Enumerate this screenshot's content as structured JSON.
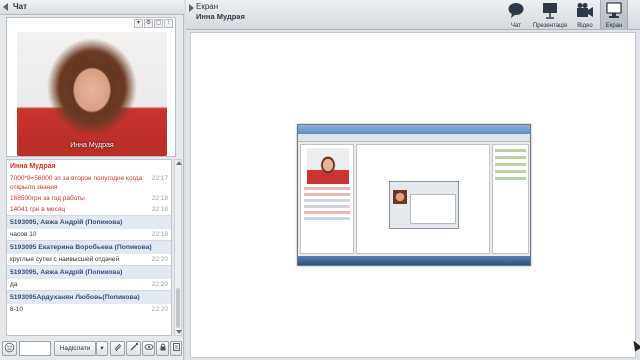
{
  "chat_panel": {
    "title": "Чат",
    "video": {
      "caption": "Инна Мудрая"
    },
    "messages": [
      {
        "type": "sender",
        "name": "Инна Мудрая"
      },
      {
        "type": "msg",
        "text": "7000*8=56000 зп за второе полугодие когда открыли звания",
        "time": "22:17",
        "style": "red"
      },
      {
        "type": "msg",
        "text": "168500грн за год работы",
        "time": "22:18",
        "style": "red"
      },
      {
        "type": "msg",
        "text": "14041 грн в месяц",
        "time": "22:18",
        "style": "red"
      },
      {
        "type": "sender",
        "name": "5193095, Авжа Андрій (Попикова)"
      },
      {
        "type": "msg",
        "text": "часов 10",
        "time": "22:19",
        "style": "plain"
      },
      {
        "type": "sender",
        "name": "5193095 Екатерина Воробьева (Попикова)"
      },
      {
        "type": "msg",
        "text": "круглые сутки с наивысшей отдачей",
        "time": "22:20",
        "style": "plain"
      },
      {
        "type": "sender",
        "name": "5193095, Авжа Андрій (Попикова)"
      },
      {
        "type": "msg",
        "text": "да",
        "time": "22:20",
        "style": "plain"
      },
      {
        "type": "sender",
        "name": "5193095Ардуханян Любовь(Попикова)"
      },
      {
        "type": "msg",
        "text": "8-10",
        "time": "22:20",
        "style": "plain"
      }
    ],
    "send_label": "Надіслати",
    "input_value": ""
  },
  "screen_panel": {
    "title": "Екран",
    "subtitle": "Инна Мудрая",
    "tools": [
      {
        "label": "Чат",
        "icon": "chat-bubble-icon",
        "active": false
      },
      {
        "label": "Презентація",
        "icon": "presentation-icon",
        "active": false
      },
      {
        "label": "Відео",
        "icon": "video-camera-icon",
        "active": false
      },
      {
        "label": "Екран",
        "icon": "monitor-icon",
        "active": true
      }
    ]
  },
  "colors": {
    "accent_red": "#c9302a",
    "sender_blue": "#35507a",
    "panel_bg": "#e6e9ec"
  }
}
